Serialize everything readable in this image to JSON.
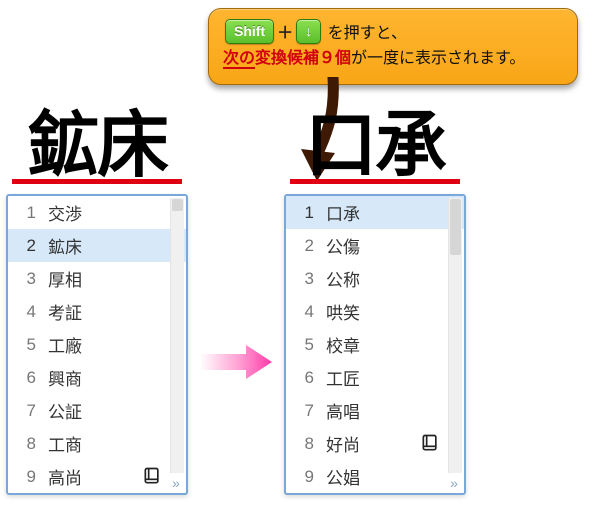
{
  "callout": {
    "key_shift": "Shift",
    "key_down": "↓",
    "text_tail": "を押すと、",
    "line2_a": "次の",
    "line2_b": "変換候補９個",
    "line2_c": "が一度に表示されます。"
  },
  "left": {
    "headline": "鉱床",
    "candidates": [
      {
        "n": "1",
        "w": "交渉"
      },
      {
        "n": "2",
        "w": "鉱床"
      },
      {
        "n": "3",
        "w": "厚相"
      },
      {
        "n": "4",
        "w": "考証"
      },
      {
        "n": "5",
        "w": "工廠"
      },
      {
        "n": "6",
        "w": "興商"
      },
      {
        "n": "7",
        "w": "公証"
      },
      {
        "n": "8",
        "w": "工商"
      },
      {
        "n": "9",
        "w": "高尚"
      }
    ],
    "selected_index": 1
  },
  "right": {
    "headline": "口承",
    "candidates": [
      {
        "n": "1",
        "w": "口承"
      },
      {
        "n": "2",
        "w": "公傷"
      },
      {
        "n": "3",
        "w": "公称"
      },
      {
        "n": "4",
        "w": "哄笑"
      },
      {
        "n": "5",
        "w": "校章"
      },
      {
        "n": "6",
        "w": "工匠"
      },
      {
        "n": "7",
        "w": "高唱"
      },
      {
        "n": "8",
        "w": "好尚"
      },
      {
        "n": "9",
        "w": "公娼"
      }
    ],
    "selected_index": 0
  }
}
